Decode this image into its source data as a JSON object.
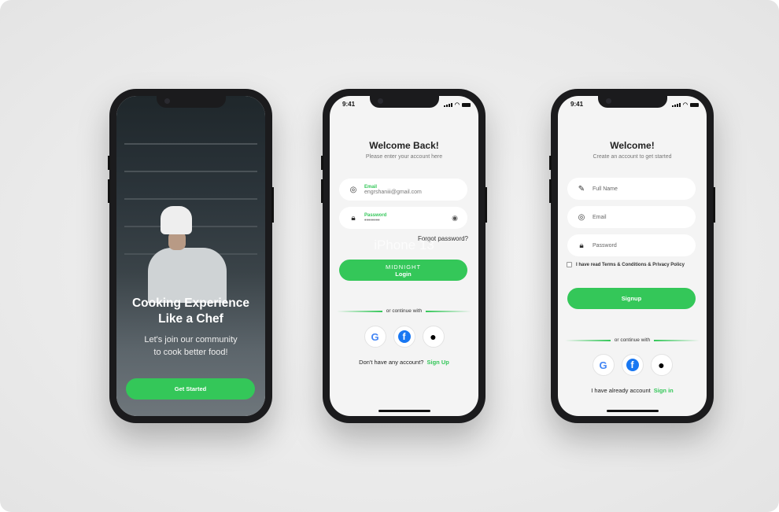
{
  "colors": {
    "accent": "#34c759",
    "background": "#ebebeb",
    "frame": "#1b1b1d"
  },
  "onboarding": {
    "title_line1": "Cooking Experience",
    "title_line2": "Like a Chef",
    "subtitle_line1": "Let's join our community",
    "subtitle_line2": "to cook better food!",
    "button": "Get Started"
  },
  "login": {
    "time": "9:41",
    "title": "Welcome Back!",
    "subtitle": "Please enter your account here",
    "email_label": "Email",
    "email_value": "engrshaniii@gmail.com",
    "password_label": "Password",
    "password_value": "••••••••",
    "forgot": "Forgot password?",
    "watermark": "iPhone 13",
    "button_top": "MIDNIGHT",
    "button": "Login",
    "divider": "or continue with",
    "footer_text": "Don't have any account?",
    "footer_link": "Sign Up"
  },
  "signup": {
    "time": "9:41",
    "title": "Welcome!",
    "subtitle": "Create an account to get started",
    "fullname_placeholder": "Full Name",
    "email_placeholder": "Email",
    "password_placeholder": "Password",
    "terms": "I have read Terms & Conditions & Privacy Policy",
    "button": "Signup",
    "divider": "or continue with",
    "footer_text": "I have already account",
    "footer_link": "Sign in"
  },
  "icons": {
    "google": "G",
    "facebook": "f",
    "apple": ""
  }
}
